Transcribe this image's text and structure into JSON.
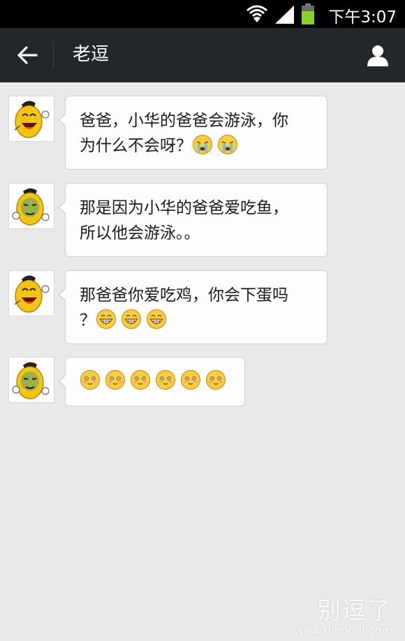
{
  "status_bar": {
    "time": "下午3:07",
    "battery_level": 0.7,
    "icons": [
      "wifi-icon",
      "signal-icon",
      "battery-icon"
    ]
  },
  "title_bar": {
    "title": "老逗",
    "back_icon": "arrow-left-icon",
    "profile_icon": "person-icon"
  },
  "messages": [
    {
      "avatar": "cartoon-mango-laughing",
      "line1": "爸爸，小华的爸爸会游泳，你",
      "line2": "为什么不会呀？",
      "emoji": [
        "crying-face",
        "crying-face"
      ]
    },
    {
      "avatar": "cartoon-mango-meme-face",
      "line1": "那是因为小华的爸爸爱吃鱼，",
      "line2": "所以他会游泳。。",
      "emoji": []
    },
    {
      "avatar": "cartoon-mango-laughing",
      "line1": "那爸爸你爱吃鸡，你会下蛋吗",
      "line2": "？",
      "emoji": [
        "grinning-face",
        "grinning-face",
        "grinning-face"
      ]
    },
    {
      "avatar": "cartoon-mango-meme-face",
      "line1": "",
      "line2": "",
      "emoji": [
        "shy-smile-face",
        "shy-smile-face",
        "shy-smile-face",
        "shy-smile-face",
        "shy-smile-face",
        "shy-smile-face"
      ]
    }
  ],
  "watermark": {
    "main": "别逗了",
    "url": "www.biedoul.com"
  },
  "colors": {
    "title_bar": "#21272a",
    "background": "#e9e9e9",
    "battery": "#8bd12b"
  }
}
